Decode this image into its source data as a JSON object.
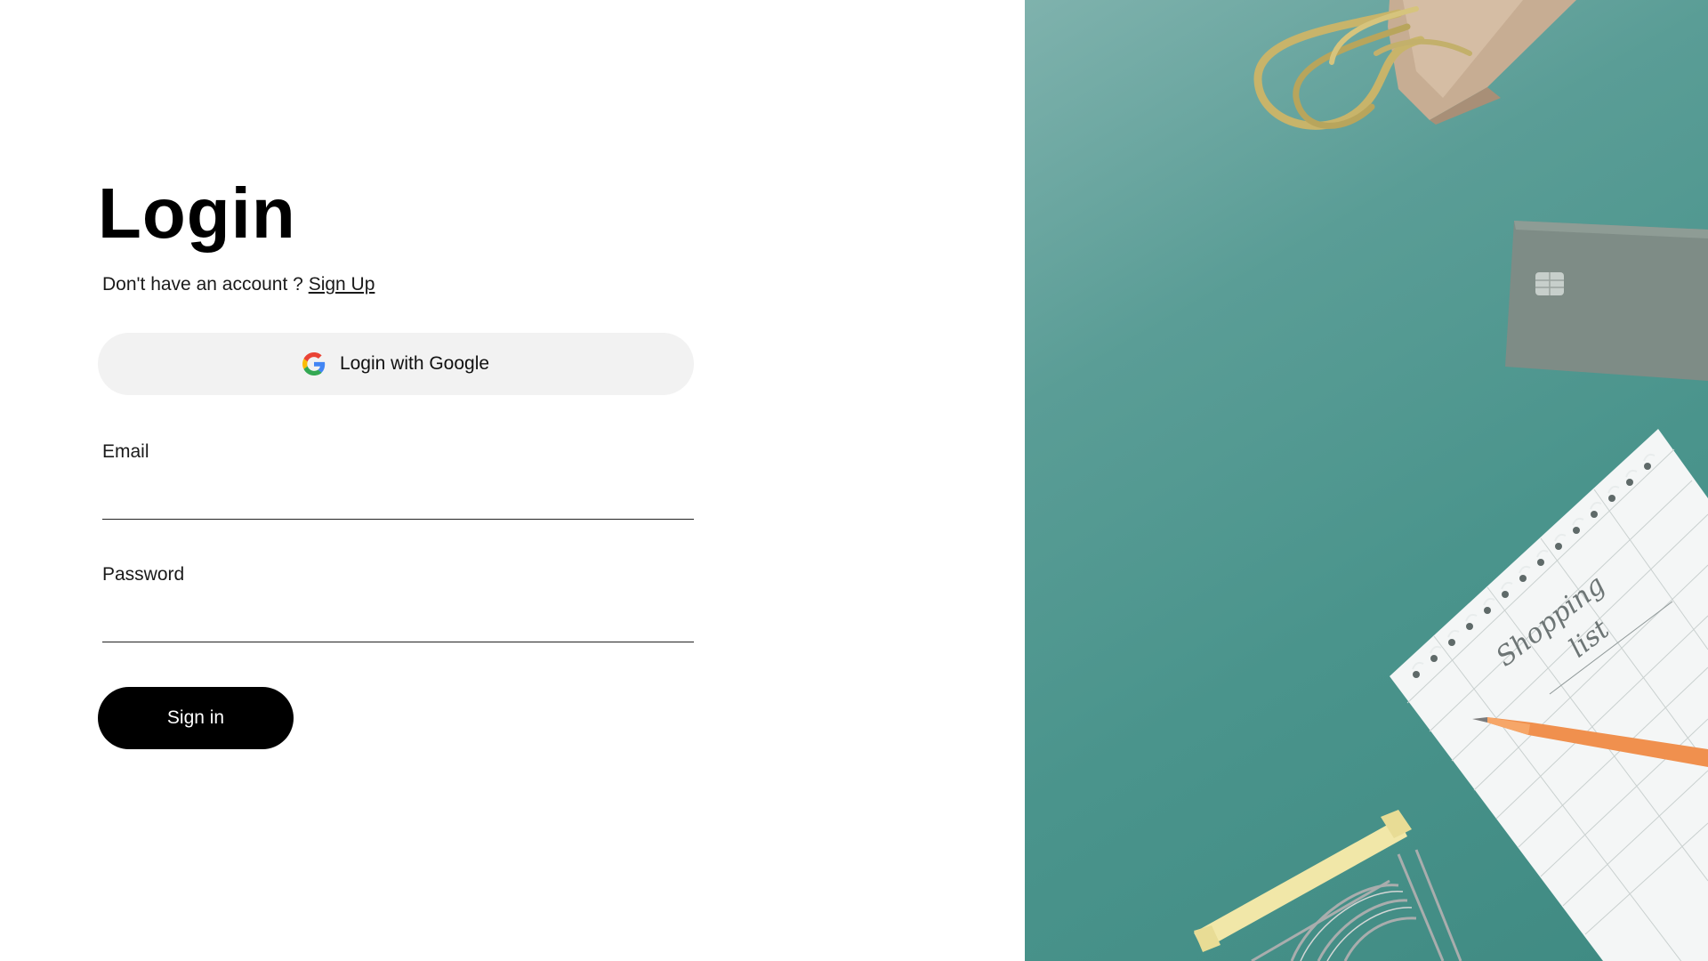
{
  "login": {
    "title": "Login",
    "no_account_text": "Don't have an account ?",
    "signup_link": "Sign Up",
    "google_button": "Login with Google",
    "email_label": "Email",
    "email_value": "",
    "password_label": "Password",
    "password_value": "",
    "signin_button": "Sign in"
  },
  "image": {
    "notebook_text_1": "Shopping",
    "notebook_text_2": "list"
  },
  "colors": {
    "background": "#ffffff",
    "google_button_bg": "#f2f2f2",
    "signin_button_bg": "#000000",
    "photo_backdrop": "#4a948c"
  }
}
